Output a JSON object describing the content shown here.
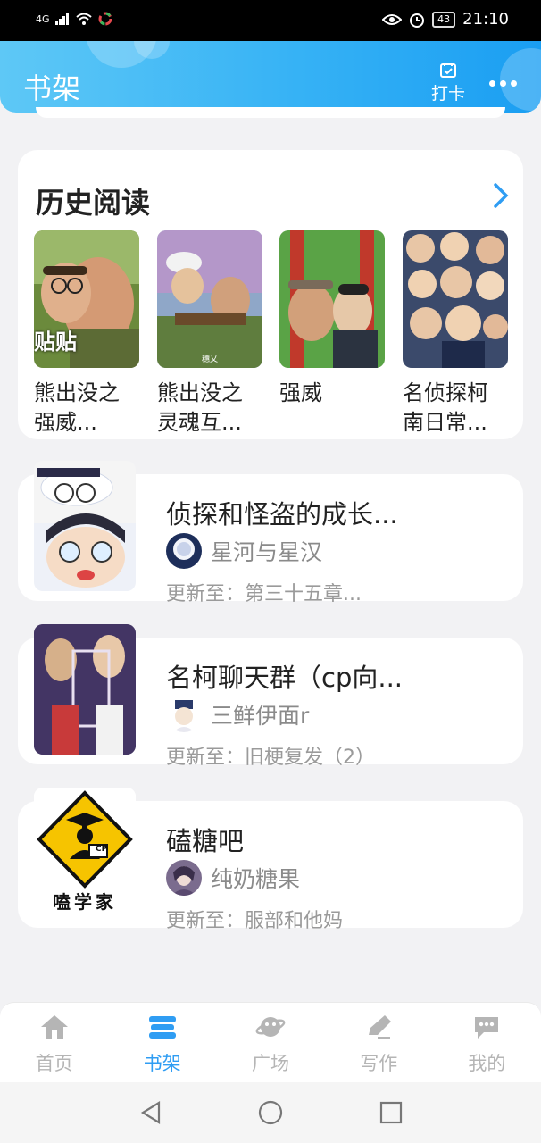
{
  "status_bar": {
    "network": "4G",
    "battery": "43",
    "time": "21:10"
  },
  "header": {
    "title": "书架",
    "checkin_label": "打卡"
  },
  "history": {
    "title": "历史阅读",
    "items": [
      {
        "name": "熊出没之强威...",
        "cover_tag": "贴贴"
      },
      {
        "name": "熊出没之灵魂互...",
        "cover_caption": "穗乂"
      },
      {
        "name": "强威"
      },
      {
        "name": "名侦探柯南日常..."
      }
    ]
  },
  "books": [
    {
      "title": "侦探和怪盗的成长...",
      "author": "星河与星汉",
      "update": "更新至：第三十五章..."
    },
    {
      "title": "名柯聊天群（cp向...",
      "author": "三鲜伊面r",
      "update": "更新至：旧梗复发（2）"
    },
    {
      "title": "磕糖吧",
      "author": "纯奶糖果",
      "update": "更新至：服部和他妈",
      "cover_text": "嗑学家",
      "cover_badge": "CP"
    }
  ],
  "bottom_nav": [
    {
      "label": "首页",
      "icon": "home-icon",
      "active": false
    },
    {
      "label": "书架",
      "icon": "bookshelf-icon",
      "active": true
    },
    {
      "label": "广场",
      "icon": "planet-icon",
      "active": false
    },
    {
      "label": "写作",
      "icon": "pen-icon",
      "active": false
    },
    {
      "label": "我的",
      "icon": "chat-bubble-icon",
      "active": false
    }
  ],
  "colors": {
    "accent": "#2f9df3",
    "header_start": "#5ec8f6",
    "header_end": "#1a9ef2",
    "background": "#f2f2f4"
  }
}
